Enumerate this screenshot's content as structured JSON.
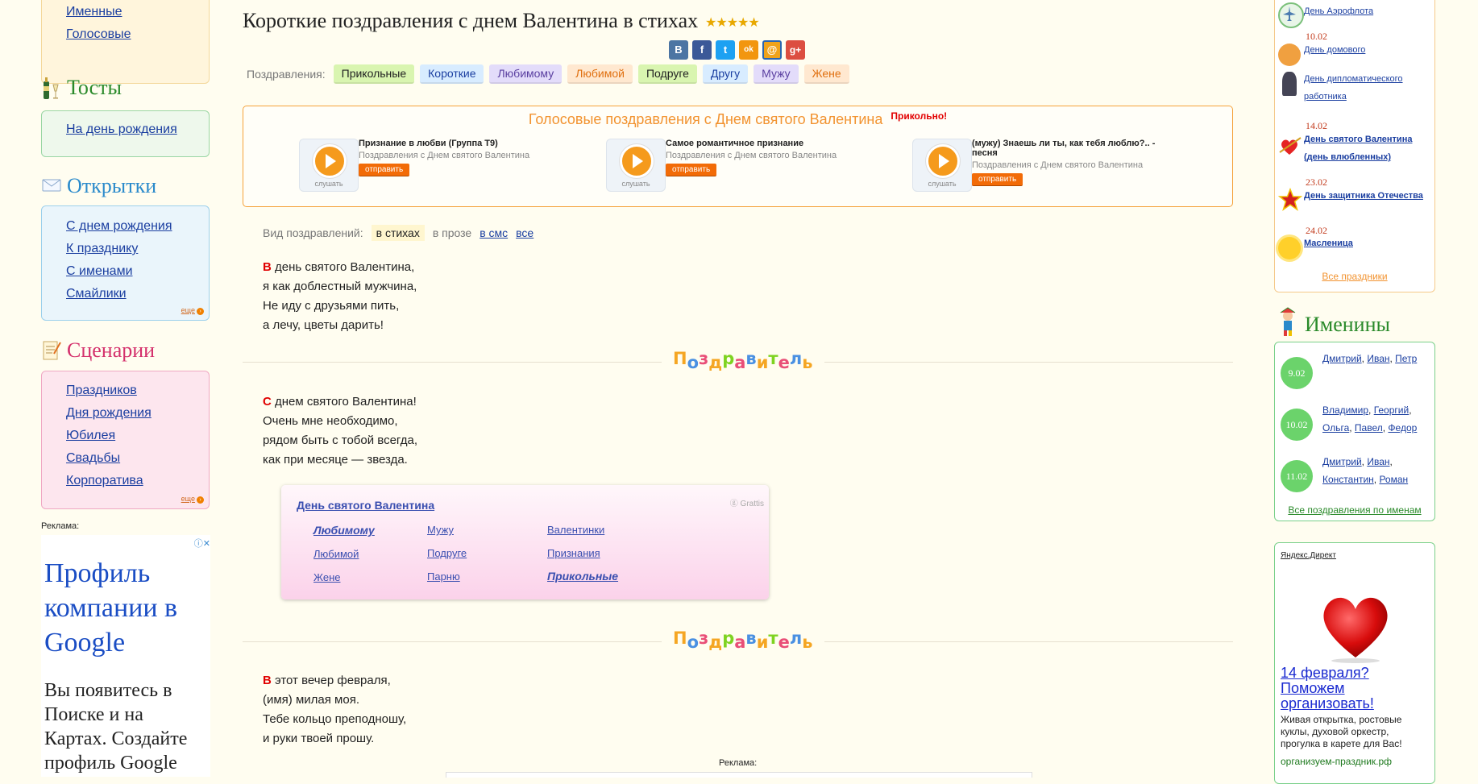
{
  "left": {
    "top_links": [
      "Именные",
      "Голосовые"
    ],
    "toasts": {
      "title": "Тосты",
      "links": [
        "На день рождения"
      ]
    },
    "cards": {
      "title": "Открытки",
      "links": [
        "С днем рождения",
        "К празднику",
        "С именами",
        "Смайлики"
      ],
      "more": "еще"
    },
    "scenarios": {
      "title": "Сценарии",
      "links": [
        "Праздников",
        "Дня рождения",
        "Юбилея",
        "Свадьбы",
        "Корпоратива"
      ],
      "more": "еще"
    },
    "ad_label": "Реклама:",
    "ad": {
      "headline": "Профиль компании в Google",
      "body": "Вы появитесь в Поиске и на Картах. Создайте профиль Google"
    }
  },
  "main": {
    "title": "Короткие поздравления с днем Валентина в стихах",
    "rating": "★★★★★",
    "share": {
      "vk": "В",
      "fb": "f",
      "tw": "t",
      "ok": "ok",
      "mail": "@",
      "gplus": "g+"
    },
    "cat_label": "Поздравления:",
    "categories": [
      {
        "label": "Прикольные",
        "bg": "#d9f5b0",
        "fg": "#2a2a2a"
      },
      {
        "label": "Короткие",
        "bg": "#d8ecff",
        "fg": "#2a2a2a"
      },
      {
        "label": "Любимому",
        "bg": "#e3dcfa",
        "fg": "#2a2a2a"
      },
      {
        "label": "Любимой",
        "bg": "#ffe8d0",
        "fg": "#e07010"
      },
      {
        "label": "Подруге",
        "bg": "#d9f5b0",
        "fg": "#2a2a2a"
      },
      {
        "label": "Другу",
        "bg": "#d8ecff",
        "fg": "#1a3ea0"
      },
      {
        "label": "Мужу",
        "bg": "#e3dcfa",
        "fg": "#5a3fa0"
      },
      {
        "label": "Жене",
        "bg": "#ffe8d0",
        "fg": "#e07010"
      }
    ],
    "voice": {
      "title": "Голосовые поздравления с Днем святого Валентина",
      "fun": "Прикольно!",
      "listen": "слушать",
      "send": "отправить",
      "items": [
        {
          "title": "Признание в любви (Группа Т9)",
          "subtitle": "Поздравления с Днем святого Валентина"
        },
        {
          "title": "Самое романтичное признание",
          "subtitle": "Поздравления с Днем святого Валентина"
        },
        {
          "title": "(мужу) Знаешь ли ты, как тебя люблю?.. - песня",
          "subtitle": "Поздравления с Днем святого Валентина"
        }
      ]
    },
    "kind": {
      "label": "Вид поздравлений:",
      "active": "в стихах",
      "prose": "в прозе",
      "sms": "в смс",
      "all": "все"
    },
    "poems": [
      {
        "first": "В",
        "lines": [
          " день святого Валентина,",
          "я как доблестный мужчина,",
          "Не иду с друзьями пить,",
          "а лечу, цветы дарить!"
        ]
      },
      {
        "first": "С",
        "lines": [
          " днем святого Валентина!",
          "Очень мне необходимо,",
          "рядом быть с тобой всегда,",
          "как при месяце — звезда."
        ]
      },
      {
        "first": "В",
        "lines": [
          " этот вечер февраля,",
          "(имя) милая моя.",
          "Тебе кольцо преподношу,",
          "и руки твоей прошу."
        ]
      }
    ],
    "separator": [
      "П",
      "о",
      "з",
      "д",
      "р",
      "а",
      "в",
      "и",
      "т",
      "е",
      "л",
      "ь"
    ],
    "separator_colors": [
      "#f5a623",
      "#4a90e2",
      "#e94e77",
      "#f5a623",
      "#7ed321",
      "#e94e77",
      "#4a90e2",
      "#f5a623",
      "#7ed321",
      "#e94e77",
      "#4a90e2",
      "#f5a623"
    ],
    "pink": {
      "title": "День святого Валентина",
      "brand": "Grattis",
      "links": [
        "Любимому",
        "Мужу",
        "Валентинки",
        "Любимой",
        "Подруге",
        "Признания",
        "Жене",
        "Парню",
        "Прикольные"
      ]
    },
    "ad_label": "Реклама:"
  },
  "right": {
    "holidays": [
      {
        "date": "",
        "name": "День Аэрофлота",
        "bold": false
      },
      {
        "date": "10.02",
        "name": "День домового",
        "bold": false
      },
      {
        "date": "",
        "name": "День дипломатического работника",
        "bold": false
      },
      {
        "date": "14.02",
        "name": "День святого Валентина (день влюбленных)",
        "bold": true
      },
      {
        "date": "23.02",
        "name": "День защитника Отечества",
        "bold": true
      },
      {
        "date": "24.02",
        "name": "Масленица",
        "bold": true
      }
    ],
    "all_holidays": "Все праздники",
    "namedays_title": "Именины",
    "namedays": [
      {
        "date": "9.02",
        "names": [
          "Дмитрий",
          "Иван",
          "Петр"
        ]
      },
      {
        "date": "10.02",
        "names": [
          "Владимир",
          "Георгий",
          "Ольга",
          "Павел",
          "Федор"
        ]
      },
      {
        "date": "11.02",
        "names": [
          "Дмитрий",
          "Иван",
          "Константин",
          "Роман"
        ]
      }
    ],
    "all_names": "Все поздравления по именам",
    "yd": {
      "label": "Яндекс.Директ",
      "headline": "14 февраля? Поможем организовать!",
      "body": "Живая открытка, ростовые куклы, духовой оркестр, прогулка в карете для Вас!",
      "domain": "организуем-праздник.рф"
    }
  }
}
